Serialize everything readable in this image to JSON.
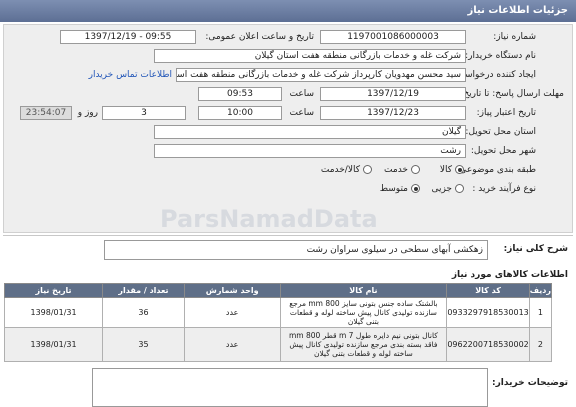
{
  "title": "جزئیات اطلاعات نیاز",
  "labels": {
    "need_number": "شماره نیاز:",
    "announce_date": "تاریخ و ساعت اعلان عمومی:",
    "buyer_org": "نام دستگاه خریدار:",
    "requester": "ایجاد کننده درخواست:",
    "response_deadline": "مهلت ارسال پاسخ: تا تاریخ:",
    "validity_deadline": "تاریخ اعتبار پیاز:",
    "time": "ساعت",
    "days_and": "روز و",
    "remaining": "ساعت باقی مانده",
    "delivery_province": "استان محل تحویل:",
    "delivery_city": "شهر محل تحویل:",
    "category": "طبقه بندی موضوعی:",
    "process_type": "نوع فرآیند خرید :",
    "general_desc": "شرح کلی نیاز:",
    "goods_info": "اطلاعات کالاهای مورد نیاز",
    "buyer_notes": "توضیحات خریدار:"
  },
  "values": {
    "need_number": "1197001086000003",
    "announce_datetime": "1397/12/19 - 09:55",
    "buyer_org": "شرکت غله و خدمات بازرگانی منطقه هفت استان گیلان",
    "requester": "سید محسن مهدویان کارپرداز شرکت غله و خدمات بازرگانی منطقه هفت استان گیلان",
    "contact_link": "اطلاعات تماس خریدار",
    "response_date": "1397/12/19",
    "response_time": "09:53",
    "validity_date": "1397/12/23",
    "validity_time": "10:00",
    "remaining_days": "3",
    "remaining_time": "23:54:07",
    "province": "گیلان",
    "city": "رشت",
    "general_desc": "زهکشی آبهای سطحی در سیلوی سراوان رشت"
  },
  "category_options": [
    "کالا",
    "خدمت",
    "کالا/خدمت"
  ],
  "category_selected": "کالا",
  "process_options": [
    "جزیی",
    "متوسط"
  ],
  "process_selected": "متوسط",
  "table": {
    "headers": [
      "ردیف",
      "کد کالا",
      "نام کالا",
      "واحد شمارش",
      "تعداد / مقدار",
      "تاریخ نیاز"
    ],
    "rows": [
      [
        "1",
        "0933297918530013",
        "بالشتک ساده جنس بتونی سایز 800 mm مرجع سازنده تولیدی کانال پیش ساخته لوله و قطعات بتنی گیلان",
        "عدد",
        "36",
        "1398/01/31"
      ],
      [
        "2",
        "0962200718530002",
        "کانال بتونی نیم دایره طول 7 m قطر 800 mm فاقد بسته بندی مرجع سازنده تولیدی کانال پیش ساخته لوله و قطعات بتنی گیلان",
        "عدد",
        "35",
        "1398/01/31"
      ]
    ]
  },
  "watermark": "ParsNamadData"
}
